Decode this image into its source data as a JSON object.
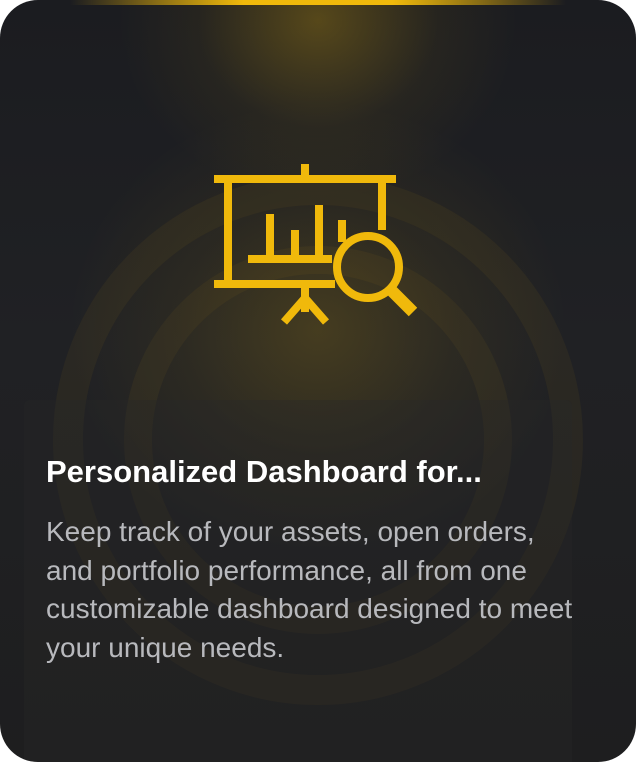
{
  "card": {
    "title": "Personalized Dashboard for...",
    "description": "Keep track of your assets, open orders, and portfolio performance, all from one customizable dashboard designed to meet your unique needs.",
    "icon": "presentation-board-with-bar-chart-and-magnifier-icon",
    "accent_color": "#f0b90b",
    "background_color": "#1e1f22",
    "text_color": "#ffffff",
    "secondary_text_color": "#b8b9bd"
  }
}
